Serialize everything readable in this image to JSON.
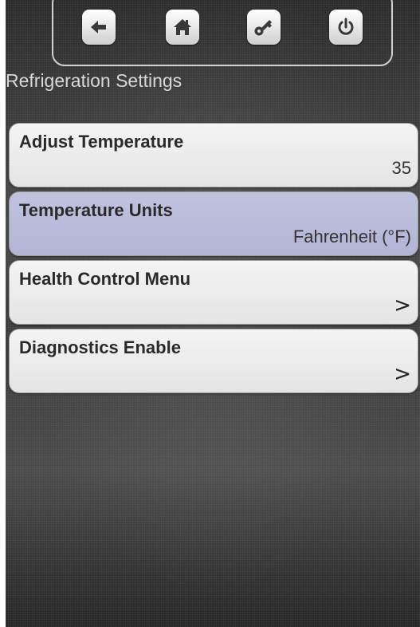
{
  "header": {
    "title": "Refrigeration Settings"
  },
  "toolbar": {
    "buttons": [
      {
        "icon": "back-arrow-icon"
      },
      {
        "icon": "home-icon"
      },
      {
        "icon": "key-icon"
      },
      {
        "icon": "power-icon"
      }
    ]
  },
  "menu": {
    "items": [
      {
        "label": "Adjust Temperature",
        "value": "35",
        "selected": false
      },
      {
        "label": "Temperature Units",
        "value": "Fahrenheit (°F)",
        "selected": true
      },
      {
        "label": "Health Control Menu",
        "chevron": ">",
        "selected": false
      },
      {
        "label": "Diagnostics Enable",
        "chevron": ">",
        "selected": false
      }
    ]
  },
  "colors": {
    "selected_row": "#b9bad9",
    "row": "#e9e9e9",
    "title_text": "#d8d8d8"
  }
}
